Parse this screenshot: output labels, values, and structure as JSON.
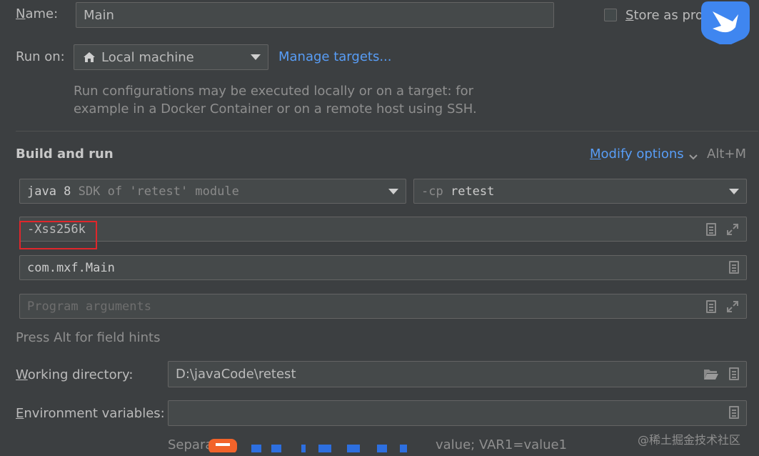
{
  "name": {
    "label": "Name:",
    "mnemonic": "N",
    "rest": "ame:",
    "value": "Main"
  },
  "store_as_project": {
    "label": "Store as pro",
    "mnemonic": "S",
    "rest": "tore as pro",
    "checked": false
  },
  "run_on": {
    "label": "Run on:",
    "target": "Local machine",
    "manage_link": "Manage targets...",
    "description_line1": "Run configurations may be executed locally or on a target: for",
    "description_line2": "example in a Docker Container or on a remote host using SSH."
  },
  "build_and_run": {
    "title": "Build and run",
    "modify_options": {
      "mnemonic": "M",
      "rest": "odify options",
      "shortcut": "Alt+M"
    },
    "jre": {
      "value_main": "java 8",
      "value_hint": "SDK of 'retest' module"
    },
    "classpath": {
      "prefix": "-cp",
      "value": "retest"
    },
    "vm_options": "-Xss256k",
    "main_class": "com.mxf.Main",
    "program_args_placeholder": "Program arguments",
    "field_hints": "Press Alt for field hints"
  },
  "working_directory": {
    "mnemonic": "W",
    "rest": "orking directory:",
    "value": "D:\\javaCode\\retest"
  },
  "environment_variables": {
    "mnemonic": "E",
    "rest": "nvironment variables:",
    "value": ""
  },
  "env_hint_partial": "Separat",
  "env_hint_partial_end": "value; VAR1=value1",
  "watermark": "@稀土掘金技术社区",
  "colors": {
    "background": "#3c3f41",
    "link": "#589df6",
    "highlight_box": "#e0262b"
  }
}
